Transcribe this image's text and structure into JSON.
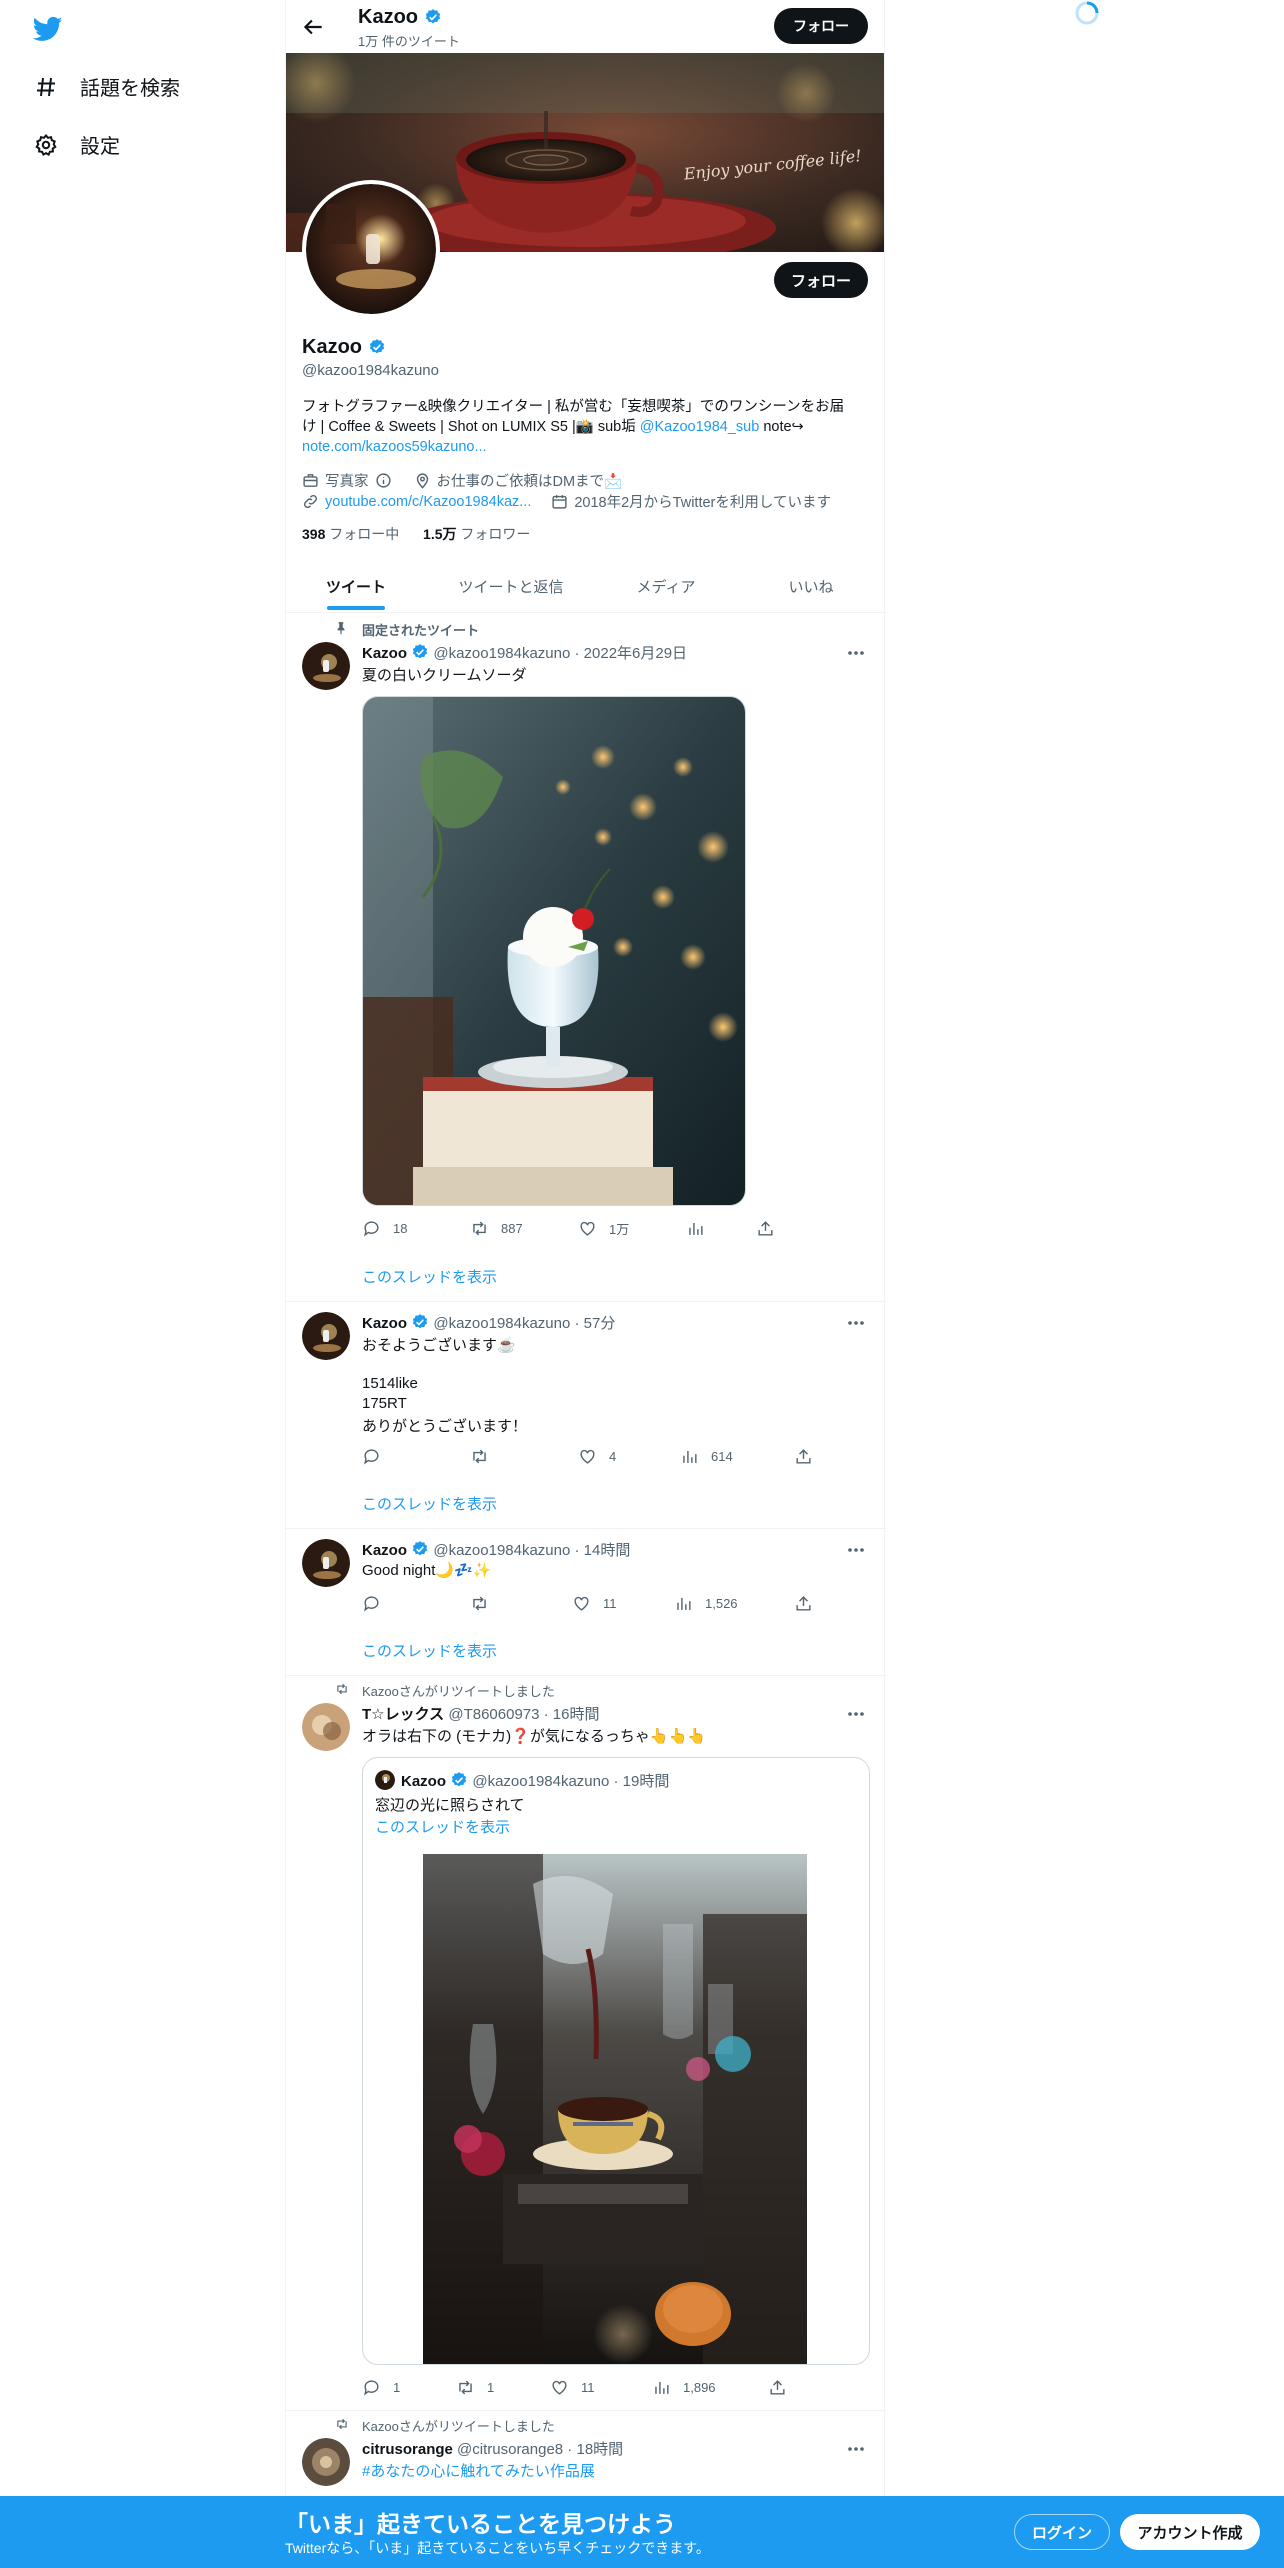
{
  "sidebar": {
    "items": [
      {
        "label": "話題を検索",
        "icon": "hashtag-icon"
      },
      {
        "label": "設定",
        "icon": "gear-icon"
      }
    ]
  },
  "header": {
    "name": "Kazoo",
    "tweet_count": "1万 件のツイート",
    "follow_label": "フォロー"
  },
  "banner": {
    "script_text": "Enjoy your coffee life!"
  },
  "profile": {
    "name": "Kazoo",
    "handle": "@kazoo1984kazuno",
    "follow_label": "フォロー",
    "bio_line1": "フォトグラファー&映像クリエイター | 私が営む「妄想喫茶」でのワンシーンをお届",
    "bio_line2_pre": "け | Coffee & Sweets | Shot on LUMIX S5 |📸 sub垢 ",
    "bio_line2_mention": "@Kazoo1984_sub",
    "bio_line2_post": " note↪",
    "bio_line3_link": "note.com/kazoos59kazuno...",
    "category": "写真家",
    "location": "お仕事のご依頼はDMまで📩",
    "website": "youtube.com/c/Kazoo1984kaz...",
    "joined": "2018年2月からTwitterを利用しています",
    "following_count": "398",
    "following_label": "フォロー中",
    "followers_count": "1.5万",
    "followers_label": "フォロワー"
  },
  "tabs": [
    {
      "label": "ツイート",
      "active": true
    },
    {
      "label": "ツイートと返信",
      "active": false
    },
    {
      "label": "メディア",
      "active": false
    },
    {
      "label": "いいね",
      "active": false
    }
  ],
  "tweets": [
    {
      "pinned_label": "固定されたツイート",
      "name": "Kazoo",
      "meta": "@kazoo1984kazuno · 2022年6月29日",
      "text": [
        "夏の白いクリームソーダ"
      ],
      "replies": "18",
      "retweets": "887",
      "likes": "1万",
      "views": "",
      "thread_link": "このスレッドを表示"
    },
    {
      "name": "Kazoo",
      "meta": "@kazoo1984kazuno · 57分",
      "text": [
        "おそようございます☕️",
        "",
        "1514like",
        "175RT",
        "ありがとうございます！"
      ],
      "replies": "",
      "retweets": "",
      "likes": "4",
      "views": "614",
      "thread_link": "このスレッドを表示"
    },
    {
      "name": "Kazoo",
      "meta": "@kazoo1984kazuno · 14時間",
      "text": [
        "Good night🌙💤✨"
      ],
      "replies": "",
      "retweets": "",
      "likes": "11",
      "views": "1,526",
      "thread_link": "このスレッドを表示"
    },
    {
      "retweet_label": "Kazooさんがリツイートしました",
      "name": "T☆レックス",
      "meta": "@T86060973 · 16時間",
      "text": [
        "オラは右下の (モナカ)❓が気になるっちゃ👆👆👆"
      ],
      "quote": {
        "name": "Kazoo",
        "meta": "@kazoo1984kazuno · 19時間",
        "text": "窓辺の光に照らされて",
        "thread_link": "このスレッドを表示"
      },
      "replies": "1",
      "retweets": "1",
      "likes": "11",
      "views": "1,896"
    },
    {
      "retweet_label": "Kazooさんがリツイートしました",
      "name": "citrusorange",
      "meta": "@citrusorange8 · 18時間",
      "text": [
        "#あなたの心に触れてみたい作品展"
      ]
    }
  ],
  "bottom_bar": {
    "title": "「いま」起きていることを見つけよう",
    "subtitle": "Twitterなら、「いま」起きていることをいち早くチェックできます。",
    "login_label": "ログイン",
    "signup_label": "アカウント作成"
  },
  "colors": {
    "accent": "#1d9bf0",
    "text": "#0f1419",
    "muted": "#536471",
    "bottom_bar": "#1d9bf0"
  }
}
